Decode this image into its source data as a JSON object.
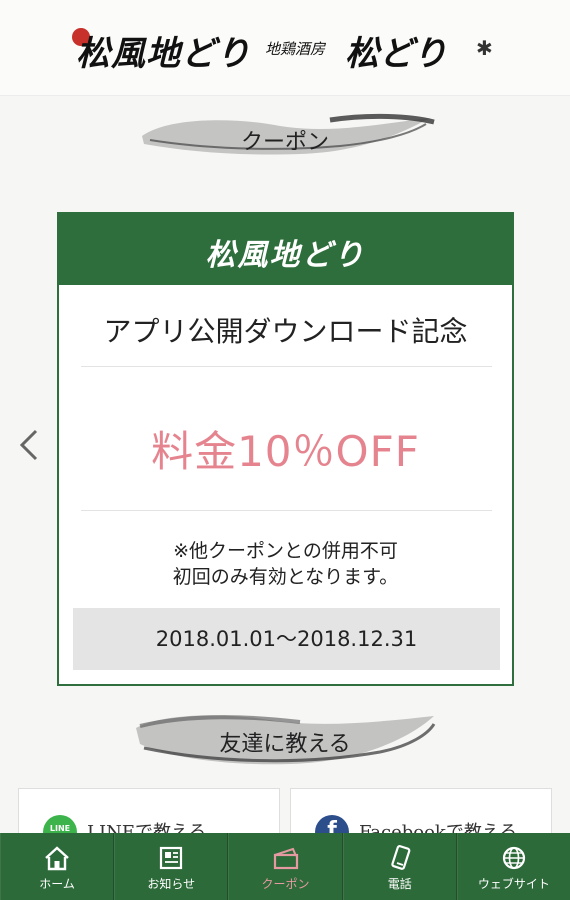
{
  "header": {
    "brand_main": "松風地どり",
    "brand_sub_small": "地鶏酒房",
    "brand_sub_big": "松どり"
  },
  "coupon_section": {
    "title": "クーポン"
  },
  "coupon": {
    "logo": "松風地どり",
    "title": "アプリ公開ダウンロード記念",
    "discount": "料金10％OFF",
    "note_line1": "※他クーポンとの併用不可",
    "note_line2": "初回のみ有効となります。",
    "period": "2018.01.01～2018.12.31"
  },
  "share_section": {
    "title": "友達に教える",
    "line_label": "LINEで教える",
    "line_icon_text": "LINE",
    "facebook_label": "Facebookで教える",
    "facebook_icon_text": "f"
  },
  "colors": {
    "brand_green": "#2e6d3c",
    "discount_pink": "#e5848e",
    "line_green": "#3cb44b",
    "facebook_blue": "#2c4f8c"
  },
  "tabbar": {
    "items": [
      {
        "label": "ホーム",
        "icon": "home-icon"
      },
      {
        "label": "お知らせ",
        "icon": "news-icon"
      },
      {
        "label": "クーポン",
        "icon": "coupon-icon"
      },
      {
        "label": "電話",
        "icon": "phone-icon"
      },
      {
        "label": "ウェブサイト",
        "icon": "globe-icon"
      }
    ],
    "active_label": "クーポン"
  }
}
